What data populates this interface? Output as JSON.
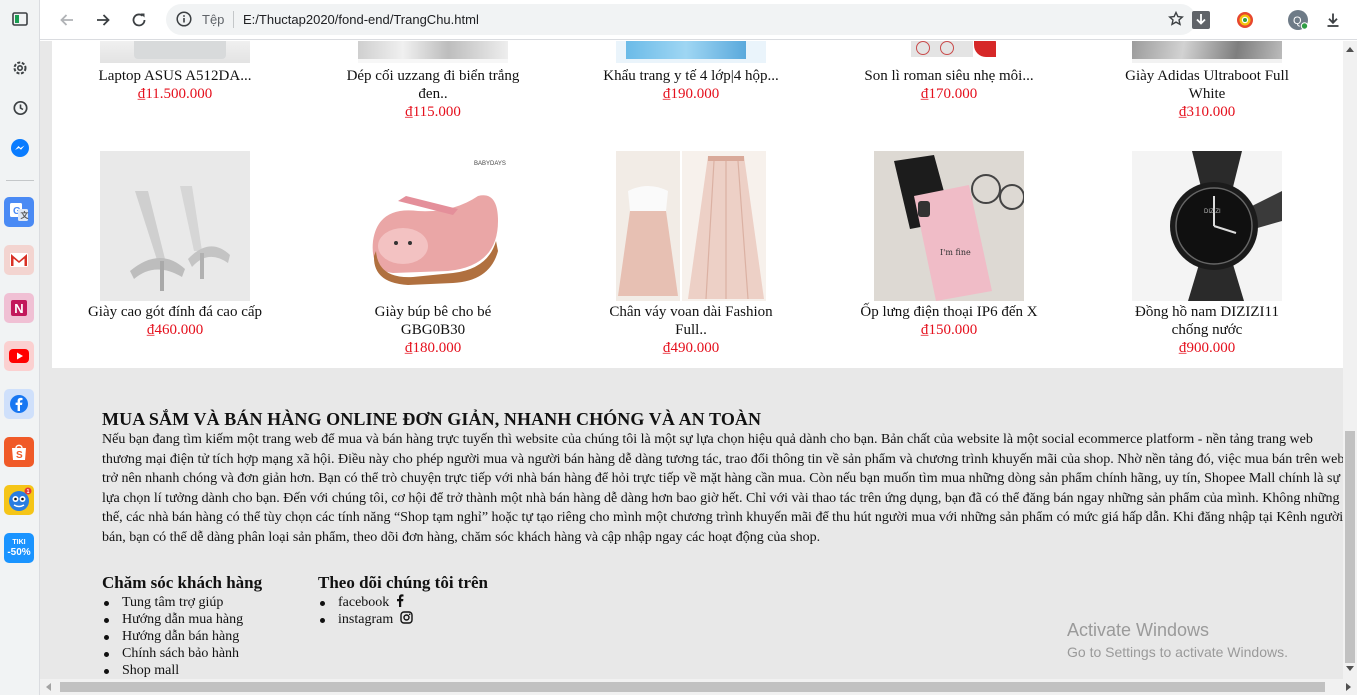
{
  "browser": {
    "security_label": "Tệp",
    "url": "E:/Thuctap2020/fond-end/TrangChu.html",
    "profile_initial": "Q"
  },
  "sidebar": {
    "apps": [
      {
        "name": "google-translate-icon",
        "label": "G",
        "color": "#4a8af4"
      },
      {
        "name": "gmail-icon",
        "label": "M",
        "color": "#e8c8c4"
      },
      {
        "name": "onenote-icon",
        "label": "N",
        "color": "#e8a8c0"
      },
      {
        "name": "youtube-icon",
        "label": "▶",
        "color": "#ee3a3a"
      },
      {
        "name": "facebook-icon",
        "label": "f",
        "color": "#3b82f0"
      },
      {
        "name": "shopee-icon",
        "label": "S",
        "color": "#f05a28"
      },
      {
        "name": "game-icon",
        "label": "",
        "color": "#f5c518"
      },
      {
        "name": "tiki-icon",
        "label": "TIKI -50%",
        "color": "#1a94ff"
      }
    ]
  },
  "products_row1": [
    {
      "name": "Laptop ASUS A512DA...",
      "price": "₫11.500.000"
    },
    {
      "name": "Dép cối uzzang đi biển trắng đen..",
      "price": "₫115.000"
    },
    {
      "name": "Khẩu trang y tế 4 lớp|4 hộp...",
      "price": "₫190.000"
    },
    {
      "name": "Son lì roman siêu nhẹ môi...",
      "price": "₫170.000"
    },
    {
      "name": "Giày Adidas Ultraboot Full White",
      "price": "₫310.000"
    }
  ],
  "products_row2": [
    {
      "name": "Giày cao gót đính đá cao cấp",
      "price": "₫460.000"
    },
    {
      "name": "Giày búp bê cho bé GBG0B30",
      "price": "₫180.000"
    },
    {
      "name": "Chân váy voan dài Fashion Full..",
      "price": "₫490.000"
    },
    {
      "name": "Ốp lưng điện thoại IP6 đến X",
      "price": "₫150.000"
    },
    {
      "name": "Đồng hồ nam DIZIZI11 chống nước",
      "price": "₫900.000"
    }
  ],
  "about": {
    "title": "MUA SẮM VÀ BÁN HÀNG ONLINE ĐƠN GIẢN, NHANH CHÓNG VÀ AN TOÀN",
    "body": "Nếu bạn đang tìm kiếm một trang web để mua và bán hàng trực tuyến thì website của chúng tôi là một sự lựa chọn hiệu quả dành cho bạn. Bản chất của website là một social ecommerce platform - nền tảng trang web thương mại điện tử tích hợp mạng xã hội. Điều này cho phép người mua và người bán hàng dễ dàng tương tác, trao đổi thông tin về sản phẩm và chương trình khuyến mãi của shop. Nhờ nền tảng đó, việc mua bán trên web trở nên nhanh chóng và đơn giản hơn. Bạn có thể trò chuyện trực tiếp với nhà bán hàng để hỏi trực tiếp về mặt hàng cần mua. Còn nếu bạn muốn tìm mua những dòng sản phẩm chính hãng, uy tín, Shopee Mall chính là sự lựa chọn lí tưởng dành cho bạn. Đến với chúng tôi, cơ hội để trở thành một nhà bán hàng dễ dàng hơn bao giờ hết. Chỉ với vài thao tác trên ứng dụng, bạn đã có thể đăng bán ngay những sản phẩm của mình. Không những thế, các nhà bán hàng có thể tùy chọn các tính năng “Shop tạm nghỉ” hoặc tự tạo riêng cho mình một chương trình khuyến mãi để thu hút người mua với những sản phẩm có mức giá hấp dẫn. Khi đăng nhập tại Kênh người bán, bạn có thể dễ dàng phân loại sản phẩm, theo dõi đơn hàng, chăm sóc khách hàng và cập nhập ngay các hoạt động của shop."
  },
  "footer": {
    "support_title": "Chăm sóc khách hàng",
    "support_links": [
      "Tung tâm trợ giúp",
      "Hướng dẫn mua hàng",
      "Hướng dẫn bán hàng",
      "Chính sách bảo hành",
      "Shop mall"
    ],
    "follow_title": "Theo dõi chúng tôi trên",
    "follow_links": [
      "facebook",
      "instagram"
    ]
  },
  "watermark": {
    "line1": "Activate Windows",
    "line2": "Go to Settings to activate Windows."
  }
}
